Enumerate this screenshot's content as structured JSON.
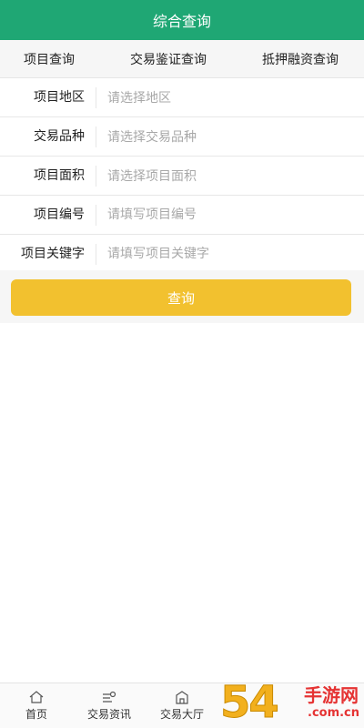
{
  "header": {
    "title": "综合查询"
  },
  "tabs": [
    {
      "label": "项目查询"
    },
    {
      "label": "交易鉴证查询"
    },
    {
      "label": "抵押融资查询"
    }
  ],
  "form": {
    "fields": [
      {
        "label": "项目地区",
        "placeholder": "请选择地区"
      },
      {
        "label": "交易品种",
        "placeholder": "请选择交易品种"
      },
      {
        "label": "项目面积",
        "placeholder": "请选择项目面积"
      },
      {
        "label": "项目编号",
        "placeholder": "请填写项目编号"
      },
      {
        "label": "项目关键字",
        "placeholder": "请填写项目关键字"
      }
    ],
    "query_label": "查询"
  },
  "bottom_nav": [
    {
      "label": "首页",
      "icon": "home-icon"
    },
    {
      "label": "交易资讯",
      "icon": "news-icon"
    },
    {
      "label": "交易大厅",
      "icon": "building-icon"
    }
  ],
  "watermark": {
    "number": "54",
    "cn_text": "手游网",
    "domain": ".com.cn"
  },
  "colors": {
    "header": "#1fa774",
    "button": "#f2c12f"
  }
}
